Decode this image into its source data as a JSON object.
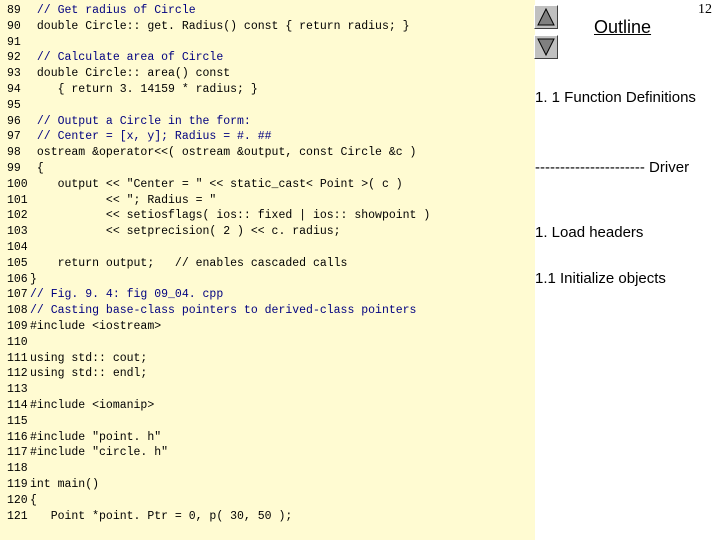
{
  "page_number": "12",
  "outline": {
    "title": "Outline",
    "items": [
      "1. 1 Function Definitions",
      "---------------------- Driver",
      "1. Load headers",
      "1.1 Initialize objects"
    ]
  },
  "nav": {
    "up_icon": "triangle-up-icon",
    "down_icon": "triangle-down-icon"
  },
  "colors": {
    "code_background": "#fffbd2",
    "comment": "#000080",
    "keyword": "#000080"
  },
  "code_lines": [
    {
      "num": "89",
      "text": " // Get radius of Circle"
    },
    {
      "num": "90",
      "text": " double Circle:: get. Radius() const { return radius; }"
    },
    {
      "num": "91",
      "text": ""
    },
    {
      "num": "92",
      "text": " // Calculate area of Circle"
    },
    {
      "num": "93",
      "text": " double Circle:: area() const"
    },
    {
      "num": "94",
      "text": "    { return 3. 14159 * radius; }"
    },
    {
      "num": "95",
      "text": ""
    },
    {
      "num": "96",
      "text": " // Output a Circle in the form:"
    },
    {
      "num": "97",
      "text": " // Center = [x, y]; Radius = #. ##"
    },
    {
      "num": "98",
      "text": " ostream &operator<<( ostream &output, const Circle &c )"
    },
    {
      "num": "99",
      "text": " {"
    },
    {
      "num": "100",
      "text": "    output << \"Center = \" << static_cast< Point >( c )"
    },
    {
      "num": "101",
      "text": "           << \"; Radius = \""
    },
    {
      "num": "102",
      "text": "           << setiosflags( ios:: fixed | ios:: showpoint )"
    },
    {
      "num": "103",
      "text": "           << setprecision( 2 ) << c. radius;"
    },
    {
      "num": "104",
      "text": ""
    },
    {
      "num": "105",
      "text": "    return output;   // enables cascaded calls"
    },
    {
      "num": "106",
      "text": "}"
    },
    {
      "num": "107",
      "text": "// Fig. 9. 4: fig 09_04. cpp"
    },
    {
      "num": "108",
      "text": "// Casting base-class pointers to derived-class pointers"
    },
    {
      "num": "109",
      "text": "#include <iostream>"
    },
    {
      "num": "110",
      "text": ""
    },
    {
      "num": "111",
      "text": "using std:: cout;"
    },
    {
      "num": "112",
      "text": "using std:: endl;"
    },
    {
      "num": "113",
      "text": ""
    },
    {
      "num": "114",
      "text": "#include <iomanip>"
    },
    {
      "num": "115",
      "text": ""
    },
    {
      "num": "116",
      "text": "#include \"point. h\""
    },
    {
      "num": "117",
      "text": "#include \"circle. h\""
    },
    {
      "num": "118",
      "text": ""
    },
    {
      "num": "119",
      "text": "int main()"
    },
    {
      "num": "120",
      "text": "{"
    },
    {
      "num": "121",
      "text": "   Point *point. Ptr = 0, p( 30, 50 );"
    }
  ]
}
